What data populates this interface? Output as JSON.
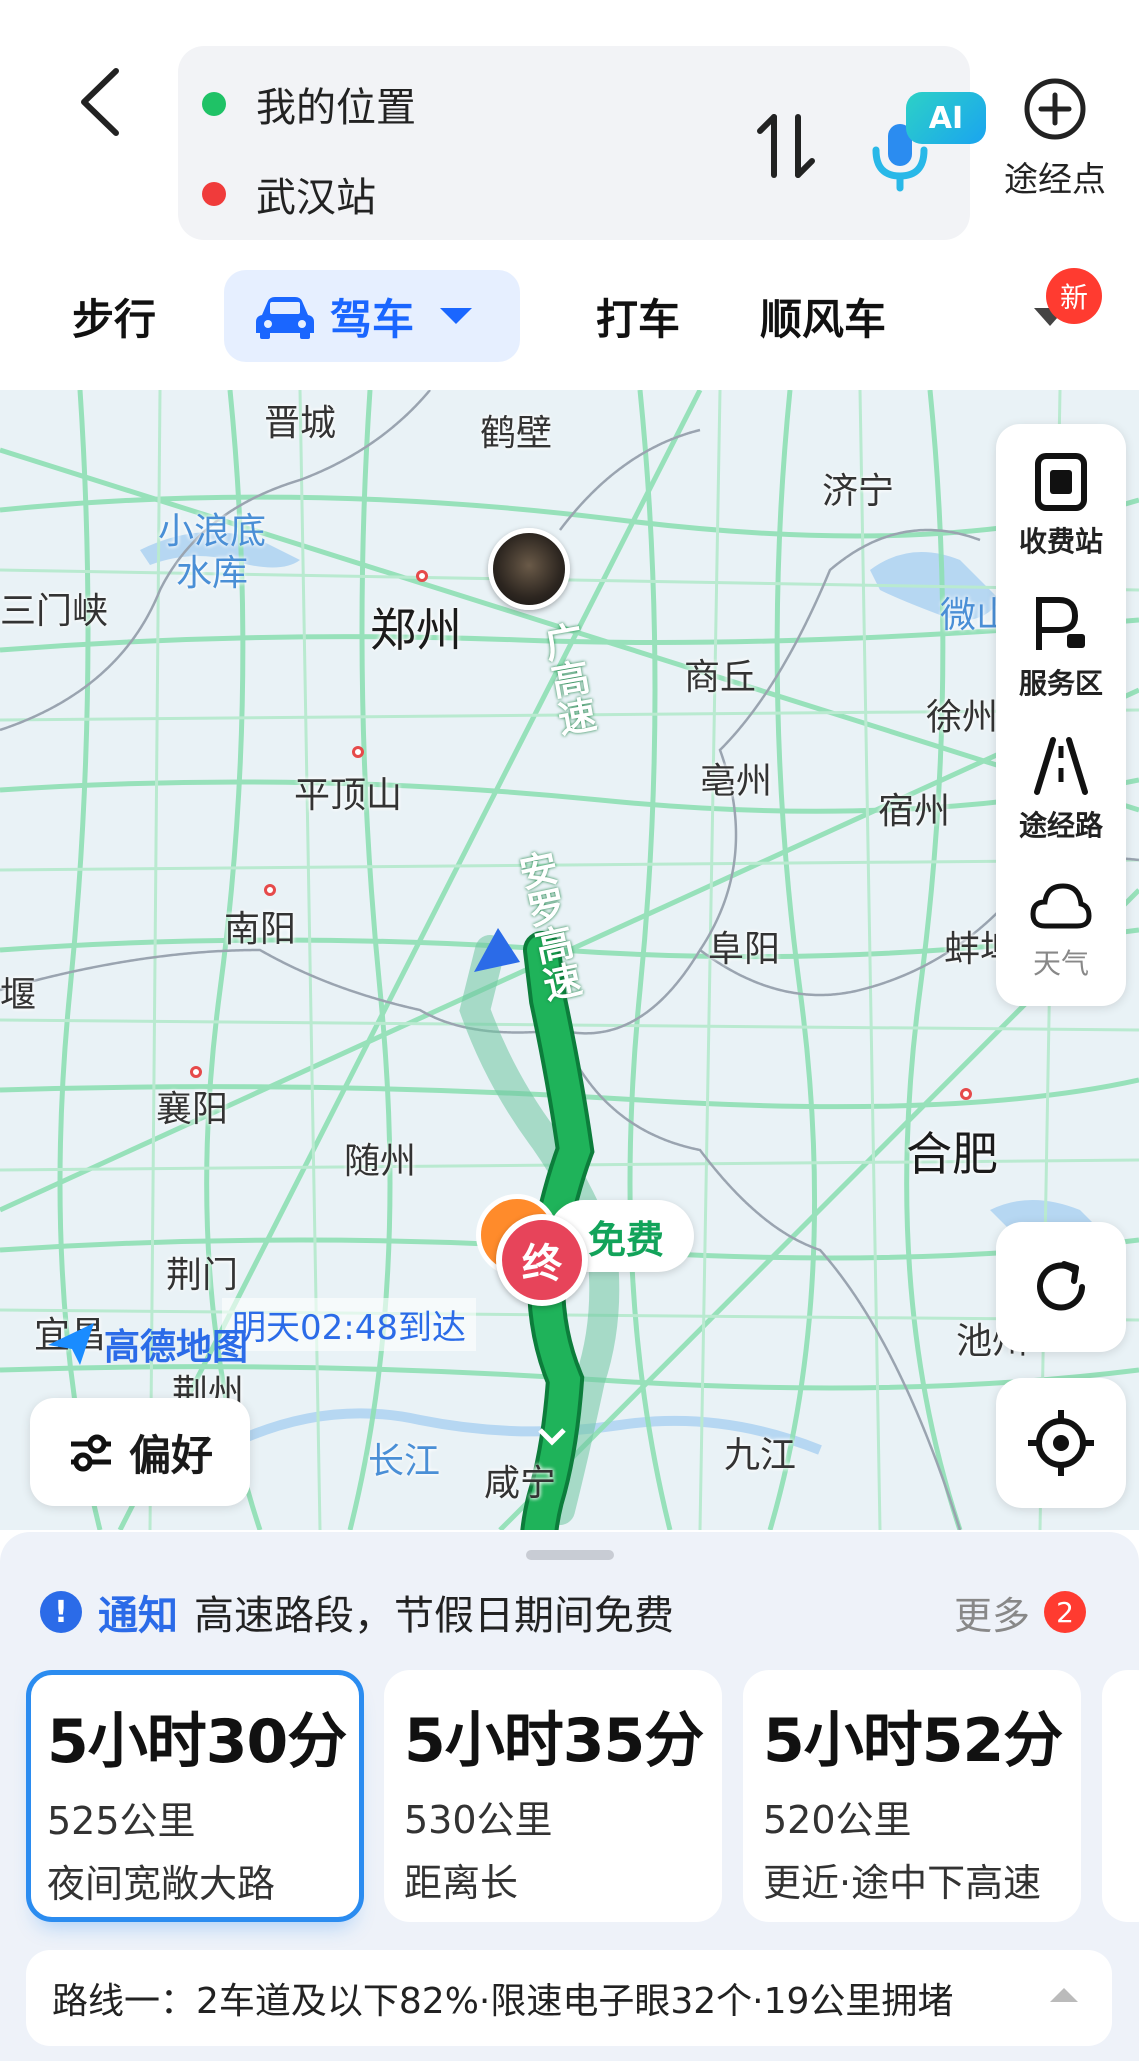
{
  "header": {
    "from": "我的位置",
    "to": "武汉站",
    "ai_label": "AI",
    "waypoint_label": "途经点"
  },
  "modes": {
    "walk": "步行",
    "drive": "驾车",
    "taxi": "打车",
    "ride": "顺风车",
    "new_badge": "新"
  },
  "map": {
    "cities": {
      "jincheng": "晋城",
      "hebi": "鹤壁",
      "jining": "济宁",
      "xiaolangdi": "小浪底",
      "shuiku": "水库",
      "sanmenxia": "三门峡",
      "zhengzhou": "郑州",
      "shangqiu": "商丘",
      "weishanhu": "微山湖",
      "xuzhou": "徐州",
      "pingdingshan": "平顶山",
      "bozhou": "亳州",
      "suzhou": "宿州",
      "nanyang": "南阳",
      "fuyang": "阜阳",
      "bengbu": "蚌埠",
      "yan": "堰",
      "xiangyang": "襄阳",
      "suizhou": "随州",
      "hefei": "合肥",
      "jingmen": "荆门",
      "yichang": "宜昌",
      "jingzhou": "荆州",
      "chizhou": "池州",
      "changjiang": "长江",
      "xianning": "咸宁",
      "jiujiang": "九江"
    },
    "roads": {
      "jingguang": "广高速",
      "anluo": "安罗高速"
    },
    "arrival": "明天02:48到达",
    "free": "免费",
    "end": "终",
    "logo": "高德地图",
    "preference": "偏好"
  },
  "side_tools": {
    "toll": "收费站",
    "service": "服务区",
    "via_road": "途经路",
    "weather": "天气"
  },
  "notice": {
    "tag": "通知",
    "message": "高速路段，节假日期间免费",
    "more": "更多",
    "count": "2"
  },
  "routes": [
    {
      "time": "5小时30分",
      "distance": "525公里",
      "desc": "夜间宽敞大路",
      "selected": true
    },
    {
      "time": "5小时35分",
      "distance": "530公里",
      "desc": "距离长",
      "selected": false
    },
    {
      "time": "5小时52分",
      "distance": "520公里",
      "desc": "更近·途中下高速",
      "selected": false
    }
  ],
  "summary": "路线一：2车道及以下82%·限速电子眼32个·19公里拥堵",
  "colors": {
    "accent": "#1a66ff",
    "route_green": "#18a84a",
    "alt_route": "#8fcfb0",
    "end_red": "#e7445a",
    "badge_red": "#ff3b30"
  }
}
